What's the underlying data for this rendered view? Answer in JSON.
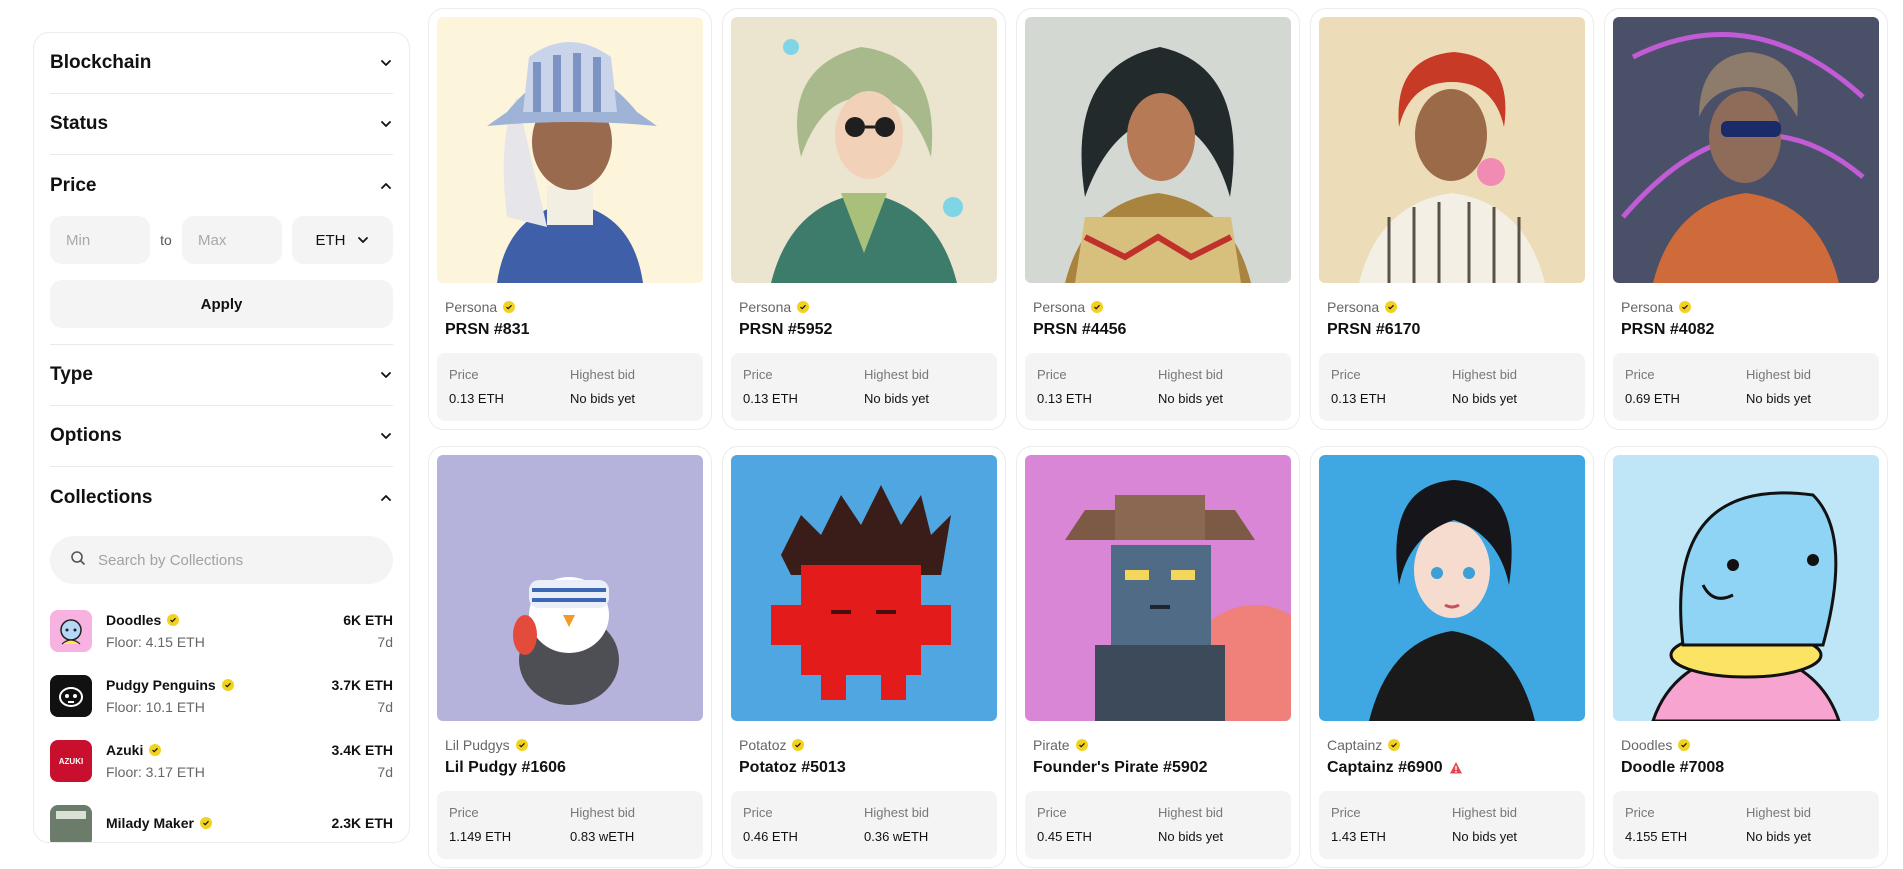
{
  "filters": {
    "blockchain": "Blockchain",
    "status": "Status",
    "price": "Price",
    "type": "Type",
    "options": "Options",
    "collections": "Collections"
  },
  "price_filter": {
    "min_placeholder": "Min",
    "to_label": "to",
    "max_placeholder": "Max",
    "currency": "ETH",
    "apply_label": "Apply"
  },
  "collection_search": {
    "placeholder": "Search by Collections"
  },
  "collections": [
    {
      "name": "Doodles",
      "floor": "Floor: 4.15 ETH",
      "volume": "6K ETH",
      "period": "7d"
    },
    {
      "name": "Pudgy Penguins",
      "floor": "Floor: 10.1 ETH",
      "volume": "3.7K ETH",
      "period": "7d"
    },
    {
      "name": "Azuki",
      "floor": "Floor: 3.17 ETH",
      "volume": "3.4K ETH",
      "period": "7d",
      "logo_text": "AZUKI"
    },
    {
      "name": "Milady Maker",
      "floor": "",
      "volume": "2.3K ETH",
      "period": ""
    }
  ],
  "stat_labels": {
    "price": "Price",
    "highest_bid": "Highest bid"
  },
  "cards": [
    {
      "collection": "Persona",
      "title": "PRSN #831",
      "price": "0.13 ETH",
      "bid": "No bids yet"
    },
    {
      "collection": "Persona",
      "title": "PRSN #5952",
      "price": "0.13 ETH",
      "bid": "No bids yet"
    },
    {
      "collection": "Persona",
      "title": "PRSN #4456",
      "price": "0.13 ETH",
      "bid": "No bids yet"
    },
    {
      "collection": "Persona",
      "title": "PRSN #6170",
      "price": "0.13 ETH",
      "bid": "No bids yet"
    },
    {
      "collection": "Persona",
      "title": "PRSN #4082",
      "price": "0.69 ETH",
      "bid": "No bids yet"
    },
    {
      "collection": "Lil Pudgys",
      "title": "Lil Pudgy #1606",
      "price": "1.149 ETH",
      "bid": "0.83 wETH"
    },
    {
      "collection": "Potatoz",
      "title": "Potatoz #5013",
      "price": "0.46 ETH",
      "bid": "0.36 wETH"
    },
    {
      "collection": "Pirate",
      "title": "Founder's Pirate #5902",
      "price": "0.45 ETH",
      "bid": "No bids yet"
    },
    {
      "collection": "Captainz",
      "title": "Captainz #6900",
      "price": "1.43 ETH",
      "bid": "No bids yet"
    },
    {
      "collection": "Doodles",
      "title": "Doodle #7008",
      "price": "4.155 ETH",
      "bid": "No bids yet"
    }
  ],
  "colors": {
    "verified": "#f2d21e",
    "warning": "#e5484d",
    "panel": "#f4f4f4"
  }
}
